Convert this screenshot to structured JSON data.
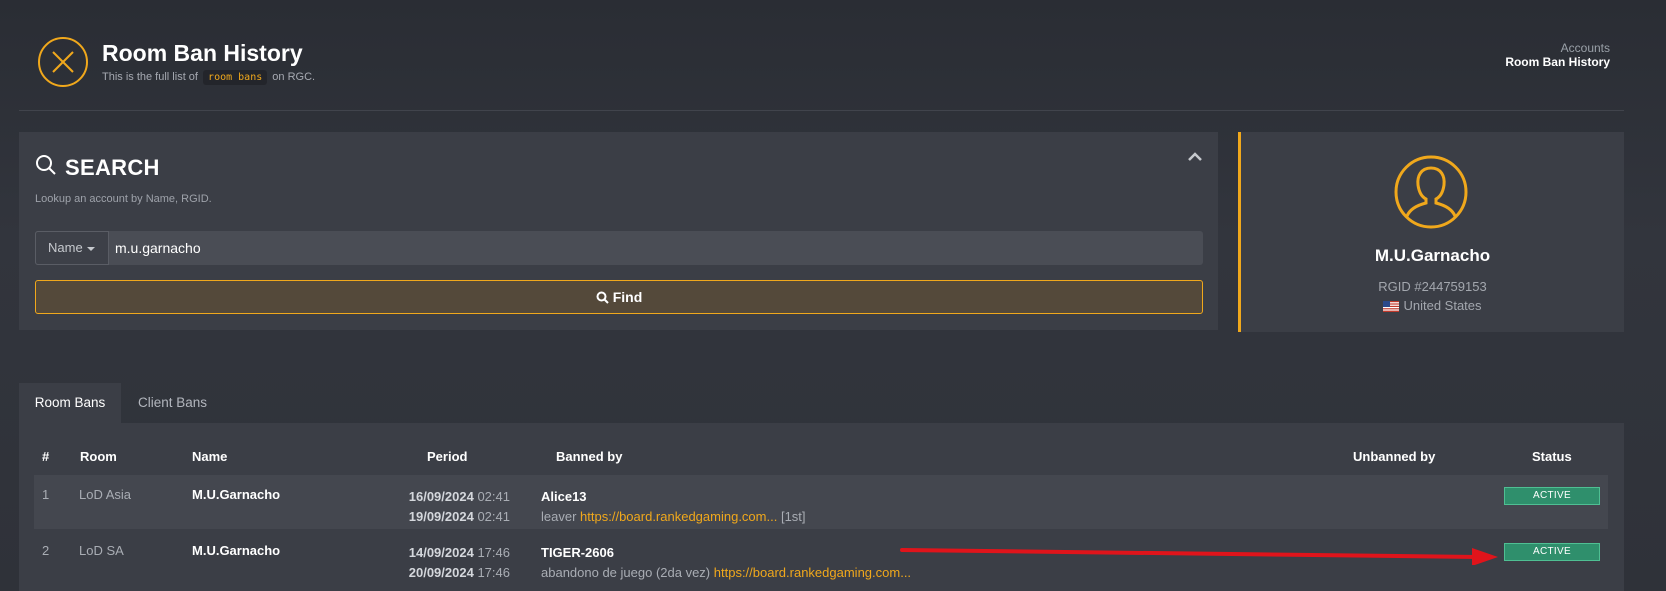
{
  "header": {
    "title": "Room Ban History",
    "subtitle_before": "This is the full list of",
    "subtitle_code": "room bans",
    "subtitle_after": "on RGC.",
    "breadcrumb": [
      "Accounts",
      "Room Ban History"
    ]
  },
  "search": {
    "title": "SEARCH",
    "hint": "Lookup an account by Name, RGID.",
    "field_type": "Name",
    "value": "m.u.garnacho",
    "find_label": "Find"
  },
  "profile": {
    "name": "M.U.Garnacho",
    "rgid": "RGID #244759153",
    "country": "United States"
  },
  "tabs": [
    {
      "label": "Room Bans",
      "active": true
    },
    {
      "label": "Client Bans",
      "active": false
    }
  ],
  "table": {
    "columns": [
      "#",
      "Room",
      "Name",
      "Period",
      "Banned by",
      "Unbanned by",
      "Status"
    ],
    "rows": [
      {
        "num": "1",
        "room": "LoD Asia",
        "name": "M.U.Garnacho",
        "start_date": "16/09/2024",
        "start_time": "02:41",
        "end_date": "19/09/2024",
        "end_time": "02:41",
        "banned_by": "Alice13",
        "reason": "leaver",
        "link": "https://board.rankedgaming.com...",
        "suffix": "[1st]",
        "status": "ACTIVE"
      },
      {
        "num": "2",
        "room": "LoD SA",
        "name": "M.U.Garnacho",
        "start_date": "14/09/2024",
        "start_time": "17:46",
        "end_date": "20/09/2024",
        "end_time": "17:46",
        "banned_by": "TIGER-2606",
        "reason": "abandono de juego (2da vez)",
        "link": "https://board.rankedgaming.com...",
        "suffix": "",
        "status": "ACTIVE"
      }
    ]
  },
  "colors": {
    "accent": "#f0a81c",
    "active_badge": "#2f8f6c",
    "annotation_arrow": "#e0141b"
  }
}
